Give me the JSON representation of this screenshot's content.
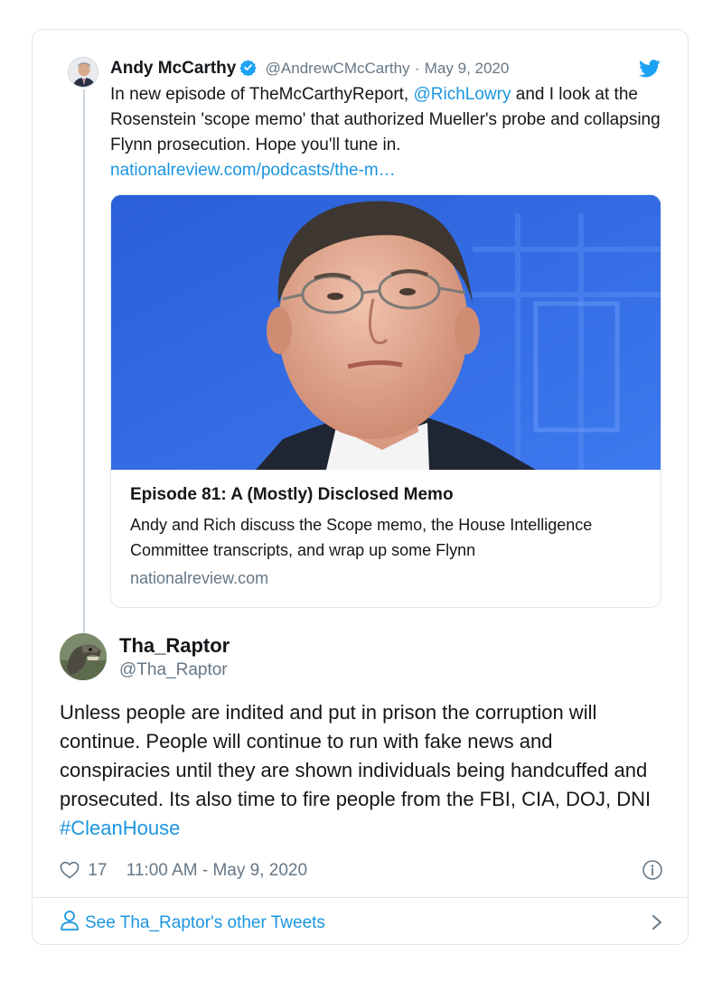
{
  "quoted_tweet": {
    "author_name": "Andy McCarthy",
    "verified_icon": "verified-badge-icon",
    "handle": "@AndrewCMcCarthy",
    "separator": "·",
    "date": "May 9, 2020",
    "text_before_mention": "In new episode of TheMcCarthyReport, ",
    "mention": "@RichLowry",
    "text_after_mention": " and I look at the Rosenstein 'scope memo' that authorized Mueller's probe and collapsing Flynn prosecution. Hope you'll tune in.",
    "url": "nationalreview.com/podcasts/the-m…",
    "card": {
      "title": "Episode 81: A (Mostly) Disclosed Memo",
      "description": "Andy and Rich discuss the Scope memo, the House Intelligence Committee transcripts, and wrap up some Flynn",
      "domain": "nationalreview.com"
    }
  },
  "reply_tweet": {
    "author_name": "Tha_Raptor",
    "handle": "@Tha_Raptor",
    "text": "Unless people are indited and put in prison the corruption will continue. People will continue to run with fake news and conspiracies until they are shown individuals being handcuffed and prosecuted. Its also time to fire people from the FBI, CIA, DOJ, DNI ",
    "hashtag": "#CleanHouse",
    "likes": "17",
    "timestamp": "11:00 AM - May 9, 2020"
  },
  "footer": {
    "label": "See Tha_Raptor's other Tweets"
  },
  "colors": {
    "link": "#1b95e0",
    "secondary_text": "#657786",
    "border": "#e1e8ed",
    "verified": "#1da1f2"
  }
}
